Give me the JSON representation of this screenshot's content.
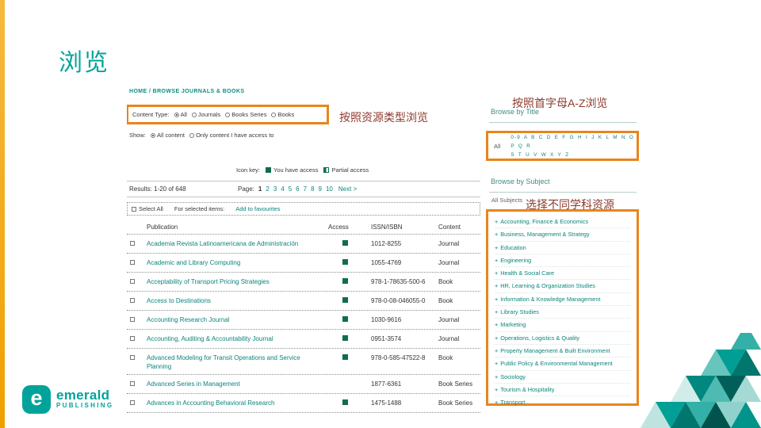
{
  "slide": {
    "title": "浏览",
    "annotations": {
      "content_type": "按照资源类型浏览",
      "az": "按照首字母A-Z浏览",
      "subject": "选择不同学科资源"
    },
    "logo": {
      "mark": "e",
      "name": "emerald",
      "subtitle": "PUBLISHING"
    }
  },
  "page": {
    "breadcrumb": "HOME / BROWSE JOURNALS & BOOKS",
    "content_type": {
      "label": "Content Type:",
      "options": [
        {
          "label": "All",
          "selected": true
        },
        {
          "label": "Journals",
          "selected": false
        },
        {
          "label": "Books Series",
          "selected": false
        },
        {
          "label": "Books",
          "selected": false
        }
      ]
    },
    "show_filter": {
      "label": "Show:",
      "options": [
        {
          "label": "All content",
          "selected": true
        },
        {
          "label": "Only content I have access to",
          "selected": false
        }
      ]
    },
    "icon_key": {
      "label": "Icon key:",
      "full_access": "You have access",
      "partial_access": "Partial access"
    },
    "results": "Results: 1-20 of 648",
    "pagination": {
      "label": "Page:",
      "pages": [
        "1",
        "2",
        "3",
        "4",
        "5",
        "6",
        "7",
        "8",
        "9",
        "10"
      ],
      "next": "Next >"
    },
    "selection_bar": {
      "select_all": "Select All",
      "for_selected": "For selected items:",
      "add_to_favourites": "Add to favourites"
    },
    "table": {
      "headers": {
        "publication": "Publication",
        "access": "Access",
        "issn": "ISSN/ISBN",
        "content": "Content"
      },
      "rows": [
        {
          "title": "Academia Revista Latinoamericana de Administración",
          "access": true,
          "issn": "1012-8255",
          "content": "Journal"
        },
        {
          "title": "Academic and Library Computing",
          "access": true,
          "issn": "1055-4769",
          "content": "Journal"
        },
        {
          "title": "Acceptability of Transport Pricing Strategies",
          "access": true,
          "issn": "978-1-78635-500-6",
          "content": "Book"
        },
        {
          "title": "Access to Destinations",
          "access": true,
          "issn": "978-0-08-046055-0",
          "content": "Book"
        },
        {
          "title": "Accounting Research Journal",
          "access": true,
          "issn": "1030-9616",
          "content": "Journal"
        },
        {
          "title": "Accounting, Auditing & Accountability Journal",
          "access": true,
          "issn": "0951-3574",
          "content": "Journal"
        },
        {
          "title": "Advanced Modeling for Transit Operations and Service Planning",
          "access": true,
          "issn": "978-0-585-47522-8",
          "content": "Book"
        },
        {
          "title": "Advanced Series in Management",
          "access": false,
          "issn": "1877-6361",
          "content": "Book Series"
        },
        {
          "title": "Advances in Accounting Behavioral Research",
          "access": true,
          "issn": "1475-1488",
          "content": "Book Series"
        }
      ]
    },
    "browse_title": {
      "heading": "Browse by Title",
      "all": "All",
      "letters_row1": "0-9 A B C D E F G H I J K L M N O P Q R",
      "letters_row2": "S T U V W X Y Z"
    },
    "browse_subject": {
      "heading": "Browse by Subject",
      "all": "All Subjects",
      "expand_glyph": "+",
      "subjects": [
        "Accounting, Finance & Economics",
        "Business, Management & Strategy",
        "Education",
        "Engineering",
        "Health & Social Care",
        "HR, Learning & Organization Studies",
        "Information & Knowledge Management",
        "Library Studies",
        "Marketing",
        "Operations, Logistics & Quality",
        "Property Management & Built Environment",
        "Public Policy & Environmental Management",
        "Sociology",
        "Tourism & Hospitality",
        "Transport"
      ]
    }
  },
  "colors": {
    "teal": "#00a39a",
    "link_teal": "#0b857b",
    "highlight_orange": "#e8851d",
    "annotation_red": "#8e3b2e",
    "access_green": "#0e6e4b",
    "edge_strip_yellow": "#f0a800"
  }
}
